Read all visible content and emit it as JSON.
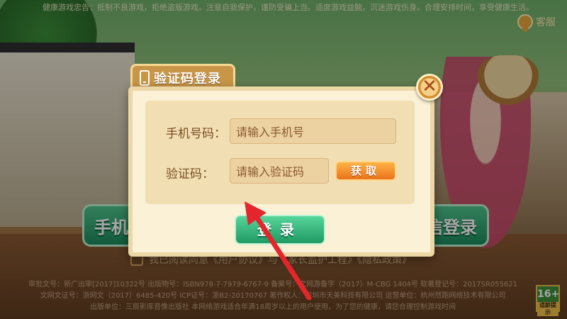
{
  "top_notice": "健康游戏忠告：抵制不良游戏，拒绝盗版游戏。注意自我保护，谨防受骗上当。适度游戏益脑，沉迷游戏伤身。合理安排时间，享受健康生活。",
  "service_label": "客服",
  "side_left_label": "手机一",
  "side_right_label": "信登录",
  "dialog": {
    "title": "验证码登录",
    "phone_label": "手机号码：",
    "phone_placeholder": "请输入手机号",
    "code_label": "验证码：",
    "code_placeholder": "请输入验证码",
    "get_code_label": "获取",
    "login_label": "登录",
    "close_symbol": "✕"
  },
  "agree_text": "我已阅读同意《用户协议》与《家长监护工程》《隐私政策》",
  "footer": {
    "line1": "审批文号：新广出审[2017]10322号 出版物号：ISBN978-7-7979-6767-9 备案号：文网游备字（2017）M-CBG 1404号 软著登记号：2017SR055621",
    "line2": "文网文证号：浙网文（2017）6485-420号 ICP证号：浙B2-20170767 著作权人：深圳市天美科技有限公司 运营单位：杭州然跑网络技术有限公司",
    "line3": "出版单位：三辰影库音像出版社 本网络游戏适合年满18周岁以上的用户使用，为了您的健康，请您合理控制游戏时间"
  },
  "age_badge": {
    "value": "16+",
    "tip": "适龄提示"
  },
  "colors": {
    "accent_green": "#1f9a63",
    "accent_orange": "#e9731a",
    "arrow_red": "#e4252b"
  }
}
